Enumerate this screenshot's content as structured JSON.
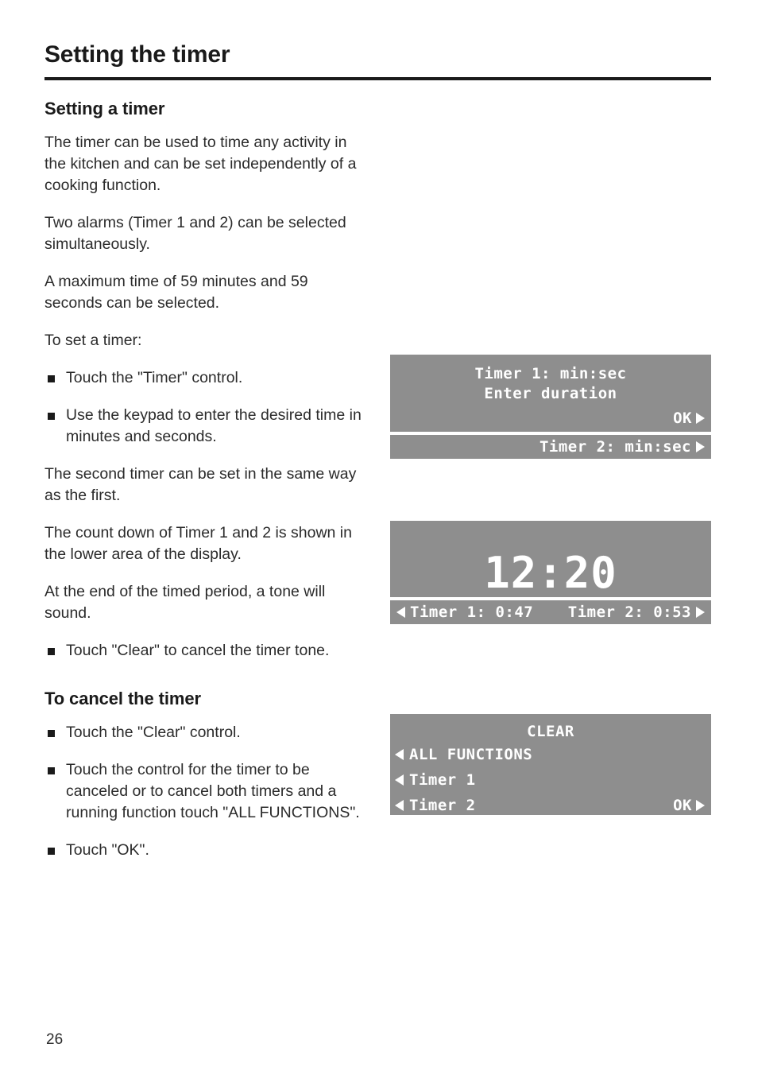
{
  "page": {
    "title": "Setting the timer",
    "number": "26"
  },
  "sections": {
    "setting_a_timer": {
      "heading": "Setting a timer",
      "paragraphs": [
        "The timer can be used to time any activity in the kitchen and can be set independently of a cooking function.",
        "Two alarms (Timer 1 and 2) can be selected simultaneously.",
        "A maximum time of 59 minutes and 59 seconds can be selected.",
        "To set a timer:"
      ],
      "bullets_1": [
        "Touch the \"Timer\" control.",
        "Use the keypad to enter the desired time in minutes and seconds."
      ],
      "paragraphs_2": [
        "The second timer can be set in the same way as the first.",
        "The count down of Timer 1 and 2 is shown in the lower area of the display.",
        "At the end of the timed period, a tone will sound."
      ],
      "bullets_2": [
        "Touch \"Clear\" to cancel the timer tone."
      ]
    },
    "to_cancel_the_timer": {
      "heading": "To cancel the timer",
      "bullets": [
        "Touch the \"Clear\" control.",
        "Touch the control for the timer to be canceled or to cancel both timers and a running function touch \"ALL FUNCTIONS\".",
        "Touch \"OK\"."
      ]
    }
  },
  "displays": {
    "panel_timer_entry": {
      "line_1": "Timer 1: min:sec",
      "line_2": "Enter duration",
      "ok_label": "OK",
      "bottom_bar": "Timer 2: min:sec"
    },
    "panel_clock": {
      "clock": "12:20",
      "timer_1": "Timer 1: 0:47",
      "timer_2": "Timer 2: 0:53"
    },
    "panel_clear": {
      "title": "CLEAR",
      "items": [
        "ALL FUNCTIONS",
        "Timer 1",
        "Timer 2"
      ],
      "ok_label": "OK"
    }
  },
  "colors": {
    "lcd_background": "#8e8e8e",
    "lcd_text": "#ffffff",
    "ink": "#1a1a1a"
  }
}
